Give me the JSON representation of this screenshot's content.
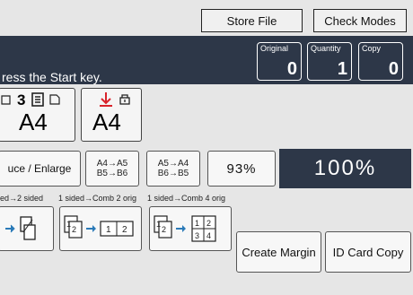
{
  "header": {
    "store_file_label": "Store File",
    "check_modes_label": "Check Modes"
  },
  "status_bar": {
    "message": "ress the Start key.",
    "counters": [
      {
        "label": "Original",
        "value": "0"
      },
      {
        "label": "Quantity",
        "value": "1"
      },
      {
        "label": "Copy",
        "value": "0"
      }
    ]
  },
  "paper_trays": [
    {
      "size": "A4",
      "tray": "3"
    },
    {
      "size": "A4",
      "tray": ""
    }
  ],
  "reduce_enlarge": {
    "label": "uce / Enlarge",
    "ratio1_line1": "A4→A5",
    "ratio1_line2": "B5→B6",
    "ratio2_line1": "A5→A4",
    "ratio2_line2": "B6→B5",
    "preset": "93%",
    "current": "100%"
  },
  "duplex": {
    "labels": [
      "ed→2 sided",
      "1 sided→Comb 2 orig",
      "1 sided→Comb 4 orig"
    ],
    "create_margin_label": "Create Margin",
    "id_card_copy_label": "ID Card Copy"
  }
}
